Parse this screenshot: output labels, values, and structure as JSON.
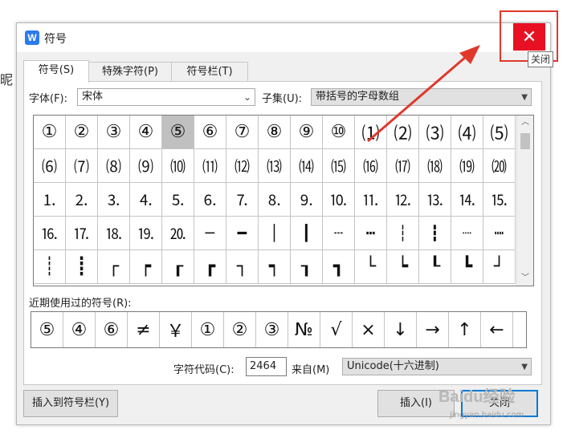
{
  "background": {
    "partial_text": "昵"
  },
  "dialog": {
    "title": "符号",
    "app_icon_letter": "W",
    "close_glyph": "✕",
    "close_tooltip": "关闭",
    "tabs": [
      {
        "label": "符号(S)",
        "active": true
      },
      {
        "label": "特殊字符(P)",
        "active": false
      },
      {
        "label": "符号栏(T)",
        "active": false
      }
    ],
    "font_label": "字体(F):",
    "font_value": "宋体",
    "subset_label": "子集(U):",
    "subset_value": "带括号的字母数组",
    "symbols": [
      [
        "①",
        "②",
        "③",
        "④",
        "⑤",
        "⑥",
        "⑦",
        "⑧",
        "⑨",
        "⑩",
        "⑴",
        "⑵",
        "⑶",
        "⑷",
        "⑸"
      ],
      [
        "⑹",
        "⑺",
        "⑻",
        "⑼",
        "⑽",
        "⑾",
        "⑿",
        "⒀",
        "⒁",
        "⒂",
        "⒃",
        "⒄",
        "⒅",
        "⒆",
        "⒇"
      ],
      [
        "⒈",
        "⒉",
        "⒊",
        "⒋",
        "⒌",
        "⒍",
        "⒎",
        "⒏",
        "⒐",
        "⒑",
        "⒒",
        "⒓",
        "⒔",
        "⒕",
        "⒖"
      ],
      [
        "⒗",
        "⒘",
        "⒙",
        "⒚",
        "⒛",
        "─",
        "━",
        "│",
        "┃",
        "┄",
        "┅",
        "┆",
        "┇",
        "┈",
        "┉"
      ],
      [
        "┊",
        "┋",
        "┌",
        "┍",
        "┎",
        "┏",
        "┐",
        "┑",
        "┒",
        "┓",
        "└",
        "┕",
        "┖",
        "┗",
        "┘"
      ]
    ],
    "selected_symbol": "⑤",
    "recent_label": "近期使用过的符号(R):",
    "recent_symbols": [
      "⑤",
      "④",
      "⑥",
      "≠",
      "￥",
      "①",
      "②",
      "③",
      "№",
      "√",
      "×",
      "↓",
      "→",
      "↑",
      "←"
    ],
    "char_code_label": "字符代码(C):",
    "char_code_value": "2464",
    "from_label": "来自(M)",
    "from_value": "Unicode(十六进制)",
    "insert_to_bar_label": "插入到符号栏(Y)",
    "insert_label": "插入(I)",
    "close_label": "关闭"
  },
  "watermark": {
    "text": "Baidu经验",
    "url": "jingyan.baidu.com"
  },
  "colors": {
    "close_red": "#e81123",
    "annotation_red": "#e0382b",
    "accent_blue": "#0078d7"
  }
}
